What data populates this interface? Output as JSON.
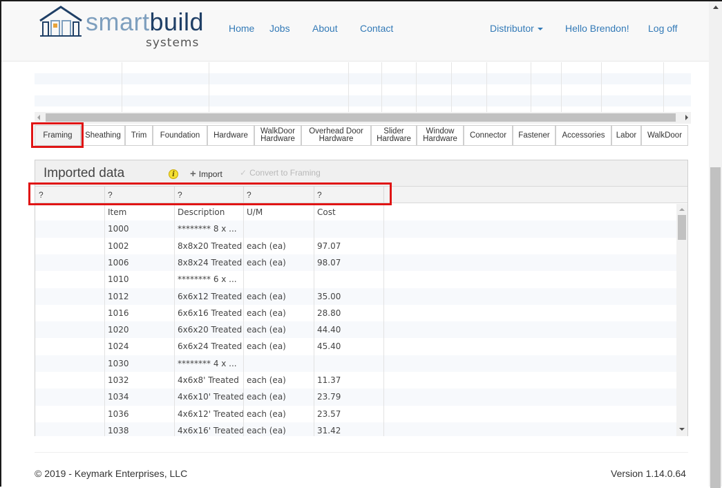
{
  "brand": {
    "word_light": "smart",
    "word_dark": "build",
    "sub": "systems"
  },
  "nav": {
    "links": [
      "Home",
      "Jobs",
      "About",
      "Contact"
    ],
    "distributor": "Distributor",
    "greeting": "Hello Brendon!",
    "logoff": "Log off"
  },
  "tabs": [
    {
      "l1": "Framing",
      "l2": ""
    },
    {
      "l1": "Sheathing",
      "l2": ""
    },
    {
      "l1": "Trim",
      "l2": ""
    },
    {
      "l1": "Foundation",
      "l2": ""
    },
    {
      "l1": "Hardware",
      "l2": ""
    },
    {
      "l1": "WalkDoor",
      "l2": "Hardware"
    },
    {
      "l1": "Overhead Door",
      "l2": "Hardware"
    },
    {
      "l1": "Slider",
      "l2": "Hardware"
    },
    {
      "l1": "Window",
      "l2": "Hardware"
    },
    {
      "l1": "Connector",
      "l2": ""
    },
    {
      "l1": "Fastener",
      "l2": ""
    },
    {
      "l1": "Accessories",
      "l2": ""
    },
    {
      "l1": "Labor",
      "l2": ""
    },
    {
      "l1": "WalkDoor",
      "l2": ""
    }
  ],
  "panel": {
    "title": "Imported data",
    "info_icon": "i",
    "import_label": "Import",
    "convert_label": "Convert to Framing",
    "column_headers": [
      "?",
      "?",
      "?",
      "?",
      "?"
    ]
  },
  "grid": {
    "rows": [
      [
        "",
        "Item",
        "Description",
        "U/M",
        "Cost"
      ],
      [
        "",
        "1000",
        "******** 8 x ...",
        "",
        ""
      ],
      [
        "",
        "1002",
        "8x8x20 Treated",
        "each (ea)",
        "97.07"
      ],
      [
        "",
        "1006",
        "8x8x24 Treated",
        "each (ea)",
        "98.07"
      ],
      [
        "",
        "1010",
        "******** 6 x ...",
        "",
        ""
      ],
      [
        "",
        "1012",
        "6x6x12 Treated",
        "each (ea)",
        "35.00"
      ],
      [
        "",
        "1016",
        "6x6x16 Treated",
        "each (ea)",
        "28.80"
      ],
      [
        "",
        "1020",
        "6x6x20 Treated",
        "each (ea)",
        "44.40"
      ],
      [
        "",
        "1024",
        "6x6x24 Treated",
        "each (ea)",
        "45.40"
      ],
      [
        "",
        "1030",
        "******** 4 x ...",
        "",
        ""
      ],
      [
        "",
        "1032",
        "4x6x8' Treated",
        "each (ea)",
        "11.37"
      ],
      [
        "",
        "1034",
        "4x6x10' Treated",
        "each (ea)",
        "23.79"
      ],
      [
        "",
        "1036",
        "4x6x12' Treated",
        "each (ea)",
        "23.57"
      ],
      [
        "",
        "1038",
        "4x6x16' Treated",
        "each (ea)",
        "31.42"
      ]
    ]
  },
  "footer": {
    "copyright": "© 2019 - Keymark Enterprises, LLC",
    "version": "Version 1.14.0.64"
  },
  "colors": {
    "accent": "#337ab7",
    "highlight": "#e01414",
    "brand_light": "#7e9fbe",
    "brand_dark": "#1f3f66"
  }
}
